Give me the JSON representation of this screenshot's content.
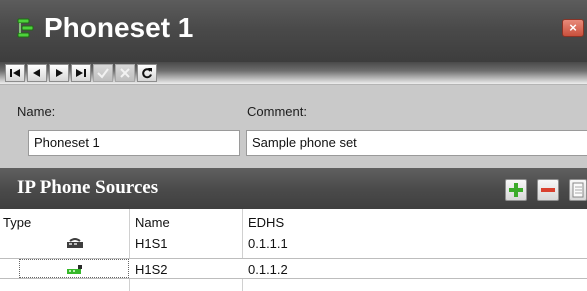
{
  "window": {
    "title": "Phoneset 1",
    "close_glyph": "×",
    "icon": "phoneset-icon"
  },
  "navigation": {
    "first_glyph": "|◀",
    "previous_glyph": "◀",
    "next_glyph": "▶",
    "last_glyph": "▶|",
    "save_glyph": "✓",
    "cancel_glyph": "✗",
    "refresh_glyph": "⟳",
    "save_enabled": false,
    "cancel_enabled": false
  },
  "form": {
    "name_label": "Name:",
    "name_value": "Phoneset 1",
    "comment_label": "Comment:",
    "comment_value": "Sample phone set"
  },
  "sources": {
    "title": "IP Phone Sources",
    "add_icon": "plus-icon",
    "remove_icon": "minus-icon",
    "details_icon": "details-icon",
    "columns": [
      "Type",
      "Name",
      "EDHS"
    ],
    "rows": [
      {
        "type_icon": "ip-phone-icon",
        "name": "H1S1",
        "edhs": "0.1.1.1"
      },
      {
        "type_icon": "ip-phone-green-icon",
        "name": "H1S2",
        "edhs": "0.1.1.2",
        "selected": true
      }
    ]
  },
  "colors": {
    "header_dark": "#4b4b4b",
    "form_band": "#c9c9c9",
    "accent_green": "#3cab2a",
    "accent_red": "#d9412f"
  }
}
